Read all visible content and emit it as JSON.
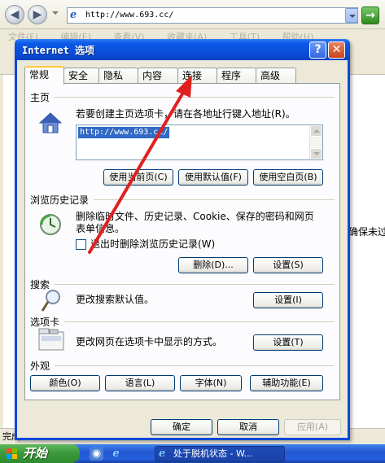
{
  "browser": {
    "address": "http://www.693.cc/",
    "menu": [
      "文件(F)",
      "编辑(E)",
      "查看(V)",
      "收藏夹(A)",
      "工具(T)",
      "帮助(H)"
    ],
    "bg_text": "确保未过",
    "status_text": "完成"
  },
  "taskbar": {
    "start_label": "开始",
    "task_label": "处于脱机状态 - W..."
  },
  "dialog": {
    "title": "Internet 选项",
    "tabs": [
      "常规",
      "安全",
      "隐私",
      "内容",
      "连接",
      "程序",
      "高级"
    ],
    "active_tab": "常规",
    "home": {
      "title": "主页",
      "desc": "若要创建主页选项卡，请在各地址行键入地址(R)。",
      "url": "http://www.693.cc/",
      "use_current": "使用当前页(C)",
      "use_default": "使用默认值(F)",
      "use_blank": "使用空白页(B)"
    },
    "history": {
      "title": "浏览历史记录",
      "desc_line1": "删除临时文件、历史记录、Cookie、保存的密码和网页",
      "desc_line2": "表单信息。",
      "checkbox_label": "退出时删除浏览历史记录(W)",
      "delete_button": "删除(D)...",
      "settings_button": "设置(S)"
    },
    "search": {
      "title": "搜索",
      "desc": "更改搜索默认值。",
      "settings_button": "设置(I)"
    },
    "tabs_section": {
      "title": "选项卡",
      "desc": "更改网页在选项卡中显示的方式。",
      "settings_button": "设置(T)"
    },
    "appearance": {
      "title": "外观",
      "colors": "颜色(O)",
      "languages": "语言(L)",
      "fonts": "字体(N)",
      "accessibility": "辅助功能(E)"
    },
    "footer": {
      "ok": "确定",
      "cancel": "取消",
      "apply": "应用(A)"
    }
  }
}
